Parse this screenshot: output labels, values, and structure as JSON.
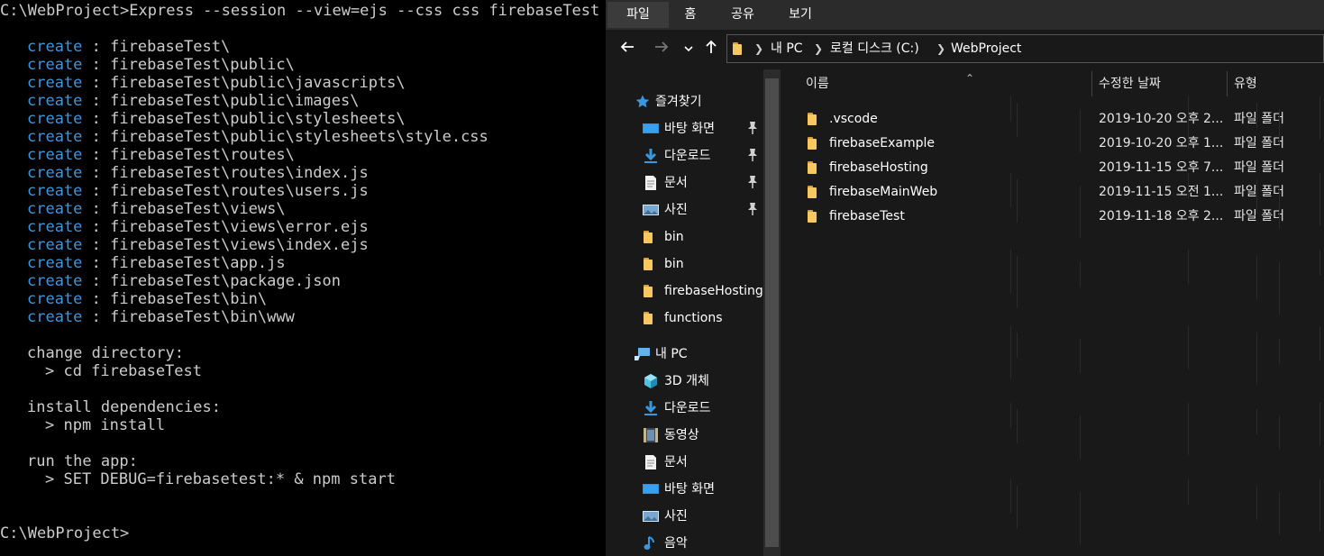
{
  "terminal": {
    "command_line": "C:\\WebProject>Express --session --view=ejs --css css firebaseTest",
    "create_keyword": "create",
    "create_separator": " : ",
    "created_paths": [
      "firebaseTest\\",
      "firebaseTest\\public\\",
      "firebaseTest\\public\\javascripts\\",
      "firebaseTest\\public\\images\\",
      "firebaseTest\\public\\stylesheets\\",
      "firebaseTest\\public\\stylesheets\\style.css",
      "firebaseTest\\routes\\",
      "firebaseTest\\routes\\index.js",
      "firebaseTest\\routes\\users.js",
      "firebaseTest\\views\\",
      "firebaseTest\\views\\error.ejs",
      "firebaseTest\\views\\index.ejs",
      "firebaseTest\\app.js",
      "firebaseTest\\package.json",
      "firebaseTest\\bin\\",
      "firebaseTest\\bin\\www"
    ],
    "change_dir_label": "change directory:",
    "change_dir_cmd": "> cd firebaseTest",
    "install_label": "install dependencies:",
    "install_cmd": "> npm install",
    "run_label": "run the app:",
    "run_cmd": "> SET DEBUG=firebasetest:* & npm start",
    "prompt": "C:\\WebProject>"
  },
  "explorer": {
    "ribbon_tabs": [
      "파일",
      "홈",
      "공유",
      "보기"
    ],
    "nav_icons": {
      "back": "arrow-left-icon",
      "forward": "arrow-right-icon",
      "recent": "chevron-down-icon",
      "up": "arrow-up-icon"
    },
    "breadcrumb": [
      "내 PC",
      "로컬 디스크 (C:)",
      "WebProject"
    ],
    "nav_pane": {
      "quick_access": "즐겨찾기",
      "quick_items": [
        {
          "label": "바탕 화면",
          "icon": "desktop-icon",
          "pinned": true
        },
        {
          "label": "다운로드",
          "icon": "download-icon",
          "pinned": true
        },
        {
          "label": "문서",
          "icon": "document-icon",
          "pinned": true
        },
        {
          "label": "사진",
          "icon": "pictures-icon",
          "pinned": true
        },
        {
          "label": "bin",
          "icon": "folder-icon",
          "pinned": false
        },
        {
          "label": "bin",
          "icon": "folder-icon",
          "pinned": false
        },
        {
          "label": "firebaseHosting",
          "icon": "folder-icon",
          "pinned": false
        },
        {
          "label": "functions",
          "icon": "folder-icon",
          "pinned": false
        }
      ],
      "this_pc": "내 PC",
      "pc_items": [
        {
          "label": "3D 개체",
          "icon": "3d-objects-icon"
        },
        {
          "label": "다운로드",
          "icon": "download-icon"
        },
        {
          "label": "동영상",
          "icon": "video-icon"
        },
        {
          "label": "문서",
          "icon": "document-icon"
        },
        {
          "label": "바탕 화면",
          "icon": "desktop-icon"
        },
        {
          "label": "사진",
          "icon": "pictures-icon"
        },
        {
          "label": "음악",
          "icon": "music-icon"
        }
      ]
    },
    "columns": {
      "name": "이름",
      "modified": "수정한 날짜",
      "type": "유형"
    },
    "files": [
      {
        "name": ".vscode",
        "modified": "2019-10-20 오후 2...",
        "type": "파일 폴더"
      },
      {
        "name": "firebaseExample",
        "modified": "2019-10-20 오후 1...",
        "type": "파일 폴더"
      },
      {
        "name": "firebaseHosting",
        "modified": "2019-11-15 오후 7...",
        "type": "파일 폴더"
      },
      {
        "name": "firebaseMainWeb",
        "modified": "2019-11-15 오전 1...",
        "type": "파일 폴더"
      },
      {
        "name": "firebaseTest",
        "modified": "2019-11-18 오후 2...",
        "type": "파일 폴더"
      }
    ]
  }
}
